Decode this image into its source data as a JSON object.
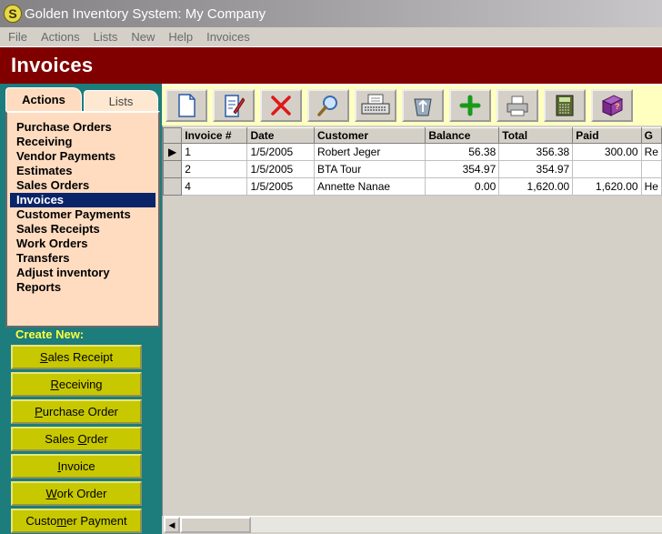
{
  "window": {
    "title": "Golden Inventory System: My Company",
    "logo": "S"
  },
  "menu": [
    "File",
    "Actions",
    "Lists",
    "New",
    "Help",
    "Invoices"
  ],
  "header": {
    "title": "Invoices"
  },
  "tabs": {
    "actions": "Actions",
    "lists": "Lists"
  },
  "actions": [
    "Purchase Orders",
    "Receiving",
    "Vendor Payments",
    "Estimates",
    "Sales Orders",
    "Invoices",
    "Customer Payments",
    "Sales Receipts",
    "Work Orders",
    "Transfers",
    "Adjust inventory",
    "Reports"
  ],
  "selected_action": "Invoices",
  "create_new": {
    "label": "Create New:",
    "buttons": [
      {
        "label": "Sales Receipt",
        "underline": "S"
      },
      {
        "label": "Receiving",
        "underline": "R"
      },
      {
        "label": "Purchase Order",
        "underline": "P"
      },
      {
        "label": "Sales Order",
        "underline": "O"
      },
      {
        "label": "Invoice",
        "underline": "I"
      },
      {
        "label": "Work Order",
        "underline": "W"
      },
      {
        "label": "Customer Payment",
        "underline": "m"
      }
    ]
  },
  "toolbar": [
    "new-document-icon",
    "edit-document-icon",
    "delete-icon",
    "search-icon",
    "typewriter-icon",
    "recycle-icon",
    "add-icon",
    "print-icon",
    "calculator-icon",
    "help-book-icon"
  ],
  "grid": {
    "columns": [
      "Invoice #",
      "Date",
      "Customer",
      "Balance",
      "Total",
      "Paid",
      "G"
    ],
    "rows": [
      {
        "invoice": "1",
        "date": "1/5/2005",
        "customer": "Robert Jeger",
        "balance": "56.38",
        "total": "356.38",
        "paid": "300.00",
        "g": "Re"
      },
      {
        "invoice": "2",
        "date": "1/5/2005",
        "customer": "BTA Tour",
        "balance": "354.97",
        "total": "354.97",
        "paid": "",
        "g": ""
      },
      {
        "invoice": "4",
        "date": "1/5/2005",
        "customer": "Annette Nanae",
        "balance": "0.00",
        "total": "1,620.00",
        "paid": "1,620.00",
        "g": "He"
      }
    ],
    "current_row": 0
  },
  "colors": {
    "header_bg": "#800000",
    "panel_bg": "#1d7c7c",
    "button_bg": "#c8c800",
    "list_bg": "#ffdcc0",
    "toolbar_bg": "#ffffc0"
  }
}
